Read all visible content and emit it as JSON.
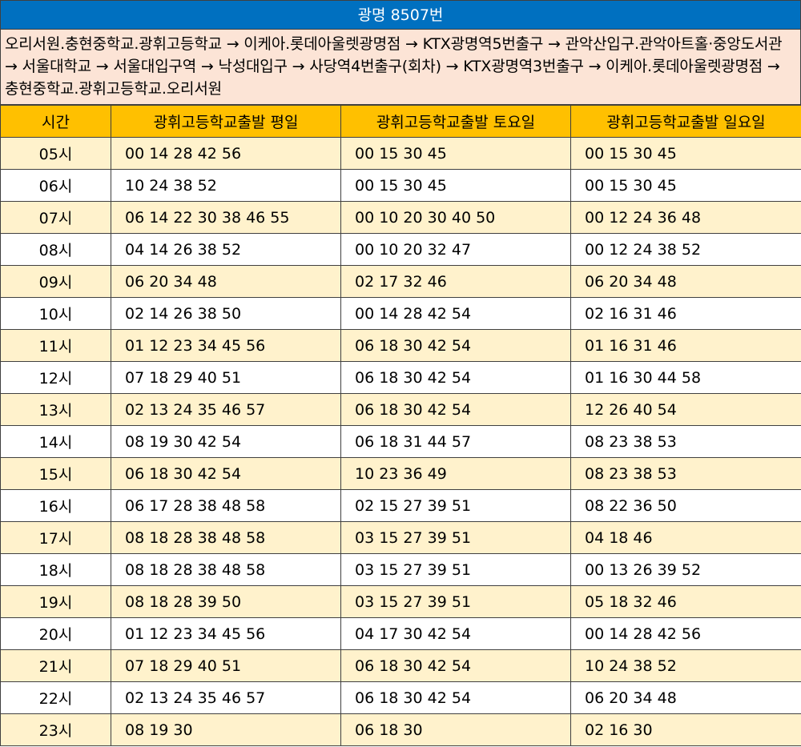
{
  "title": "광명 8507번",
  "route": "오리서원.충현중학교.광휘고등학교 → 이케아.롯데아울렛광명점 → KTX광명역5번출구 → 관악산입구.관악아트홀·중앙도서관 → 서울대학교 → 서울대입구역 → 낙성대입구 → 사당역4번출구(회차) → KTX광명역3번출구 → 이케아.롯데아울렛광명점 → 충현중학교.광휘고등학교.오리서원",
  "headers": {
    "hour": "시간",
    "weekday": "광휘고등학교출발 평일",
    "saturday": "광휘고등학교출발 토요일",
    "sunday": "광휘고등학교출발 일요일"
  },
  "rows": [
    {
      "hour": "05시",
      "weekday": "00 14 28 42 56",
      "saturday": "00 15 30 45",
      "sunday": "00 15 30 45"
    },
    {
      "hour": "06시",
      "weekday": "10 24 38 52",
      "saturday": "00 15 30 45",
      "sunday": "00 15 30 45"
    },
    {
      "hour": "07시",
      "weekday": "06 14 22 30 38 46 55",
      "saturday": "00 10 20 30 40 50",
      "sunday": "00 12 24 36 48"
    },
    {
      "hour": "08시",
      "weekday": "04 14 26 38 52",
      "saturday": "00 10 20 32 47",
      "sunday": "00 12 24 38 52"
    },
    {
      "hour": "09시",
      "weekday": "06 20 34 48",
      "saturday": "02 17 32 46",
      "sunday": "06 20 34 48"
    },
    {
      "hour": "10시",
      "weekday": "02 14 26 38 50",
      "saturday": "00 14 28 42 54",
      "sunday": "02 16 31 46"
    },
    {
      "hour": "11시",
      "weekday": "01 12 23 34 45 56",
      "saturday": "06 18 30 42 54",
      "sunday": "01 16 31 46"
    },
    {
      "hour": "12시",
      "weekday": "07 18 29 40 51",
      "saturday": "06 18 30 42 54",
      "sunday": "01 16 30 44 58"
    },
    {
      "hour": "13시",
      "weekday": "02 13 24 35 46 57",
      "saturday": "06 18 30 42 54",
      "sunday": "12 26 40 54"
    },
    {
      "hour": "14시",
      "weekday": "08 19 30 42 54",
      "saturday": "06 18 31 44 57",
      "sunday": "08 23 38 53"
    },
    {
      "hour": "15시",
      "weekday": "06 18 30 42 54",
      "saturday": "10 23 36 49",
      "sunday": "08 23 38 53"
    },
    {
      "hour": "16시",
      "weekday": "06 17 28 38 48 58",
      "saturday": "02 15 27 39 51",
      "sunday": "08 22 36 50"
    },
    {
      "hour": "17시",
      "weekday": "08 18 28 38 48 58",
      "saturday": "03 15 27 39 51",
      "sunday": "04 18 46"
    },
    {
      "hour": "18시",
      "weekday": "08 18 28 38 48 58",
      "saturday": "03 15 27 39 51",
      "sunday": "00 13 26 39 52"
    },
    {
      "hour": "19시",
      "weekday": "08 18 28 39 50",
      "saturday": "03 15 27 39 51",
      "sunday": "05 18 32 46"
    },
    {
      "hour": "20시",
      "weekday": "01 12 23 34 45 56",
      "saturday": "04 17 30 42 54",
      "sunday": "00 14 28 42 56"
    },
    {
      "hour": "21시",
      "weekday": "07 18 29 40 51",
      "saturday": "06 18 30 42 54",
      "sunday": "10 24 38 52"
    },
    {
      "hour": "22시",
      "weekday": "02 13 24 35 46 57",
      "saturday": "06 18 30 42 54",
      "sunday": "06 20 34 48"
    },
    {
      "hour": "23시",
      "weekday": "08 19 30",
      "saturday": "06 18 30",
      "sunday": "02 16 30"
    }
  ],
  "colors": {
    "title_bg": "#0070c0",
    "route_bg": "#fce4d6",
    "header_bg": "#ffc000",
    "odd_row_bg": "#fff2cc",
    "even_row_bg": "#ffffff"
  }
}
